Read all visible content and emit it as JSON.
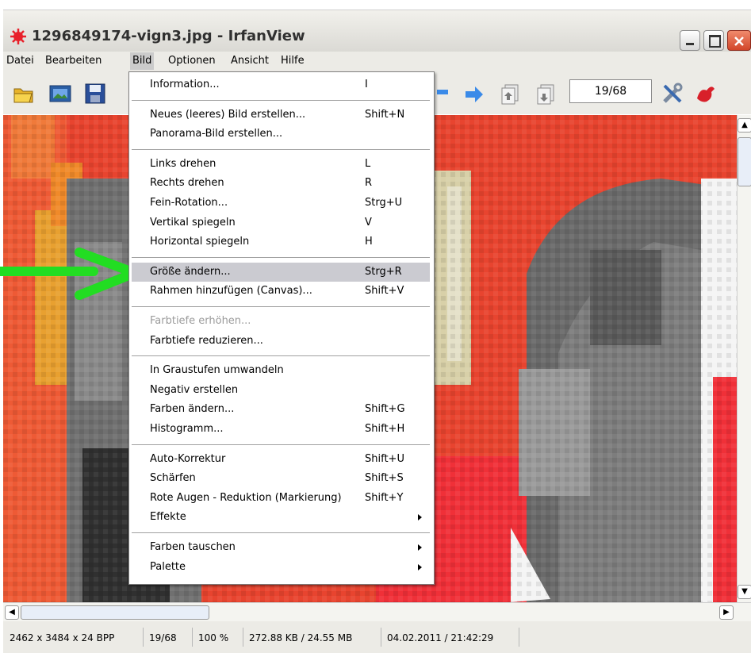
{
  "window": {
    "title": "1296849174-vign3.jpg - IrfanView",
    "buttons": [
      "minimize",
      "maximize",
      "close"
    ]
  },
  "menubar": {
    "items": [
      {
        "label": "Datei"
      },
      {
        "label": "Bearbeiten"
      },
      {
        "label": "Bild",
        "active": true
      },
      {
        "label": "Optionen"
      },
      {
        "label": "Ansicht"
      },
      {
        "label": "Hilfe"
      }
    ]
  },
  "toolbar": {
    "page_indicator": "19/68",
    "icons": [
      "open-folder-icon",
      "slideshow-icon",
      "save-icon",
      "left-arrow-icon",
      "right-arrow-icon",
      "first-page-icon",
      "last-page-icon",
      "settings-tools-icon",
      "irfanview-logo-icon"
    ]
  },
  "bild_menu": {
    "items": [
      {
        "label": "Information...",
        "shortcut": "I"
      },
      {
        "separator": true
      },
      {
        "label": "Neues (leeres) Bild erstellen...",
        "shortcut": "Shift+N"
      },
      {
        "label": "Panorama-Bild erstellen...",
        "shortcut": ""
      },
      {
        "separator": true
      },
      {
        "label": "Links drehen",
        "shortcut": "L"
      },
      {
        "label": "Rechts drehen",
        "shortcut": "R"
      },
      {
        "label": "Fein-Rotation...",
        "shortcut": "Strg+U"
      },
      {
        "label": "Vertikal spiegeln",
        "shortcut": "V"
      },
      {
        "label": "Horizontal spiegeln",
        "shortcut": "H"
      },
      {
        "separator": true
      },
      {
        "label": "Größe ändern...",
        "shortcut": "Strg+R",
        "highlighted": true
      },
      {
        "label": "Rahmen hinzufügen (Canvas)...",
        "shortcut": "Shift+V"
      },
      {
        "separator": true
      },
      {
        "label": "Farbtiefe erhöhen...",
        "shortcut": "",
        "disabled": true
      },
      {
        "label": "Farbtiefe reduzieren...",
        "shortcut": ""
      },
      {
        "separator": true
      },
      {
        "label": "In Graustufen umwandeln",
        "shortcut": ""
      },
      {
        "label": "Negativ erstellen",
        "shortcut": ""
      },
      {
        "label": "Farben ändern...",
        "shortcut": "Shift+G"
      },
      {
        "label": "Histogramm...",
        "shortcut": "Shift+H"
      },
      {
        "separator": true
      },
      {
        "label": "Auto-Korrektur",
        "shortcut": "Shift+U"
      },
      {
        "label": "Schärfen",
        "shortcut": "Shift+S"
      },
      {
        "label": "Rote Augen - Reduktion (Markierung)",
        "shortcut": "Shift+Y"
      },
      {
        "label": "Effekte",
        "shortcut": "",
        "submenu": true
      },
      {
        "separator": true
      },
      {
        "label": "Farben tauschen",
        "shortcut": "",
        "submenu": true
      },
      {
        "label": "Palette",
        "shortcut": "",
        "submenu": true
      }
    ]
  },
  "statusbar": {
    "dimensions": "2462 x 3484 x 24 BPP",
    "page": "19/68",
    "zoom": "100 %",
    "size": "272.88 KB / 24.55 MB",
    "datetime": "04.02.2011 / 21:42:29"
  },
  "colors": {
    "highlight": "#cbcbd1",
    "annotation_arrow": "#22dd22",
    "image_red": "#e8402f",
    "image_gray": "#6e6e6e"
  }
}
